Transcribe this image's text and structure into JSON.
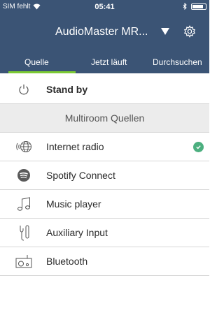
{
  "status": {
    "carrier": "SIM fehlt",
    "time": "05:41",
    "battery_level": 0.85
  },
  "header": {
    "device_title": "AudioMaster MR...",
    "dropdown_icon": "chevron-down-icon",
    "settings_icon": "gear-icon",
    "background": "#3b5475"
  },
  "tabs": [
    {
      "label": "Quelle",
      "active": true
    },
    {
      "label": "Jetzt läuft",
      "active": false
    },
    {
      "label": "Durchsuchen",
      "active": false
    }
  ],
  "accent": "#7ccb34",
  "list": {
    "standby": {
      "label": "Stand by",
      "icon": "power-icon"
    },
    "section_header": "Multiroom Quellen",
    "sources": [
      {
        "label": "Internet radio",
        "icon": "globe-radio-icon",
        "selected": true
      },
      {
        "label": "Spotify Connect",
        "icon": "spotify-icon",
        "selected": false
      },
      {
        "label": "Music player",
        "icon": "music-note-icon",
        "selected": false
      },
      {
        "label": "Auxiliary  Input",
        "icon": "aux-plug-icon",
        "selected": false
      },
      {
        "label": "Bluetooth",
        "icon": "radio-speaker-icon",
        "selected": false
      }
    ]
  }
}
